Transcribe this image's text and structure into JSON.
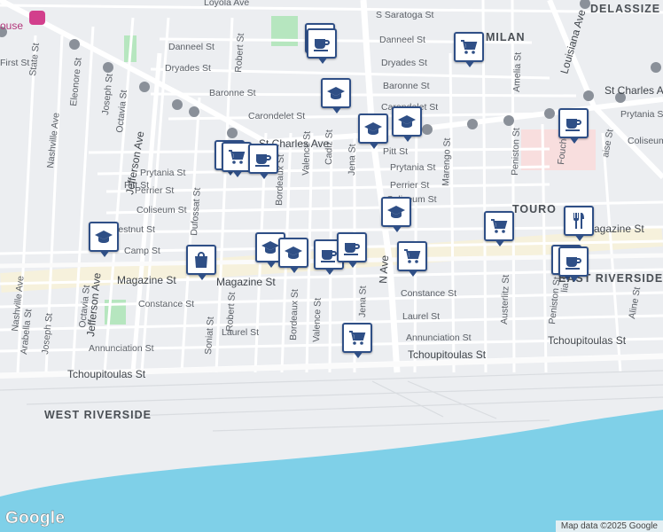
{
  "map": {
    "neighborhoods": [
      "DELASSIZE",
      "MILAN",
      "TOURO",
      "EAST RIVERSIDE",
      "WEST RIVERSIDE"
    ],
    "poi_label": "ouse",
    "streets": {
      "loyola": "Loyola Ave",
      "s_saratoga": "S Saratoga St",
      "danneel_left": "Danneel St",
      "danneel_right": "Danneel St",
      "dryades_left": "Dryades St",
      "dryades_right": "Dryades St",
      "baronne_left": "Baronne St",
      "baronne_right": "Baronne St",
      "carondelet_left": "Carondelet St",
      "carondelet_right": "Carondelet St",
      "st_charles_left": "St Charles Ave",
      "st_charles_right": "St Charles Ave",
      "pitt_left": "Pitt St",
      "pitt_right": "Pitt St",
      "prytania_left": "Prytania St",
      "prytania_mid": "Prytania St",
      "prytania_right": "Prytania St",
      "perrier_left": "Perrier St",
      "perrier_right": "Perrier St",
      "coliseum_left": "Coliseum St",
      "coliseum_mid": "Coliseum St",
      "coliseum_right": "Coliseum",
      "chestnut": "Chestnut St",
      "camp": "Camp St",
      "magazine_left": "Magazine St",
      "magazine_mid": "Magazine St",
      "magazine_right": "Magazine St",
      "constance_left": "Constance St",
      "constance_right": "Constance St",
      "laurel_left": "Laurel St",
      "laurel_right": "Laurel St",
      "annunciation_left": "Annunciation St",
      "annunciation_right": "Annunciation St",
      "tchoupitoulas_left": "Tchoupitoulas St",
      "tchoupitoulas_mid": "Tchoupitoulas St",
      "tchoupitoulas_right": "Tchoupitoulas St",
      "jefferson": "Jefferson Ave",
      "jefferson_lower": "Jefferson Ave",
      "nashville": "Nashville Ave",
      "nashville_lower": "Nashville Ave",
      "octavia": "Octavia St",
      "octavia_lower": "Octavia St",
      "joseph": "Joseph St",
      "joseph_lower": "Joseph St",
      "eleonore": "Eleonore St",
      "state": "State St",
      "arabella": "Arabella St",
      "first": "First St",
      "soniat": "Soniat St",
      "dufossat": "Dufossat St",
      "robert": "Robert St",
      "robert_lower": "Robert St",
      "bordeaux": "Bordeaux St",
      "bordeaux_lower": "Bordeaux St",
      "valence": "Valence St",
      "valence_lower": "Valence St",
      "cadiz": "Cadiz St",
      "jena": "Jena St",
      "jena_lower": "Jena St",
      "napoleon": "N   Ave",
      "marengo": "Marengo St",
      "amelia": "Amelia St",
      "peniston": "Peniston St",
      "peniston_lower": "Peniston St",
      "austerlitz": "Austerlitz St",
      "louisiana": "Louisiana Ave",
      "foucher": "Foucher St",
      "aline": "Aline St",
      "delachaise": "aise St",
      "amelia_lower": "lia St"
    },
    "colors": {
      "land": "#eceef1",
      "water": "#7fd0e8",
      "street": "#ffffff",
      "major_street": "#fbfbfb",
      "park": "#b6e6bf",
      "commercial": "#f6f1dc",
      "hospital": "#f8dede",
      "marker_border": "#2f4f86",
      "route_badge": "#8a9099"
    },
    "markers": [
      {
        "icon": "coffee-icon",
        "category": "cafe"
      },
      {
        "icon": "coffee-icon",
        "category": "cafe"
      },
      {
        "icon": "cart-icon",
        "category": "grocery"
      },
      {
        "icon": "school-icon",
        "category": "school"
      },
      {
        "icon": "school-icon",
        "category": "school"
      },
      {
        "icon": "school-icon",
        "category": "school"
      },
      {
        "icon": "coffee-icon",
        "category": "cafe"
      },
      {
        "icon": "coffee-icon",
        "category": "cafe"
      },
      {
        "icon": "cart-icon",
        "category": "grocery"
      },
      {
        "icon": "coffee-icon",
        "category": "cafe"
      },
      {
        "icon": "school-icon",
        "category": "school"
      },
      {
        "icon": "cart-icon",
        "category": "grocery"
      },
      {
        "icon": "restaurant-icon",
        "category": "restaurant"
      },
      {
        "icon": "shopping-bag-icon",
        "category": "shopping"
      },
      {
        "icon": "school-icon",
        "category": "school"
      },
      {
        "icon": "school-icon",
        "category": "school"
      },
      {
        "icon": "coffee-icon",
        "category": "cafe"
      },
      {
        "icon": "coffee-icon",
        "category": "cafe"
      },
      {
        "icon": "school-icon",
        "category": "school"
      },
      {
        "icon": "cart-icon",
        "category": "grocery"
      }
    ]
  },
  "footer": {
    "logo": "Google",
    "attribution": "Map data ©2025 Google"
  }
}
